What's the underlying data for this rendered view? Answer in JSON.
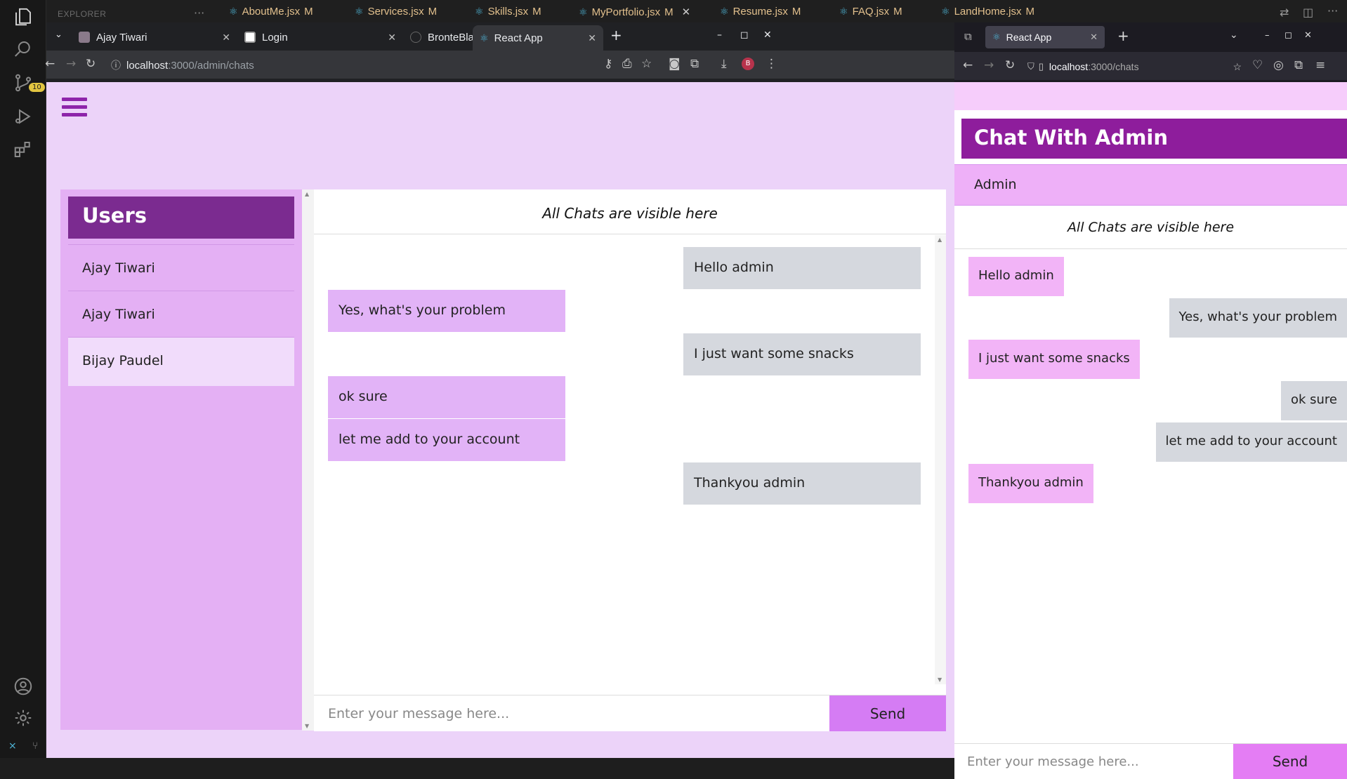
{
  "vscode": {
    "explorer_label": "EXPLORER",
    "scm_badge": "10",
    "tabs": [
      {
        "name": "AboutMe.jsx",
        "status": "M"
      },
      {
        "name": "Services.jsx",
        "status": "M"
      },
      {
        "name": "Skills.jsx",
        "status": "M"
      },
      {
        "name": "MyPortfolio.jsx",
        "status": "M"
      },
      {
        "name": "Resume.jsx",
        "status": "M"
      },
      {
        "name": "FAQ.jsx",
        "status": "M"
      },
      {
        "name": "LandHome.jsx",
        "status": "M"
      }
    ]
  },
  "chrome": {
    "tabs": [
      {
        "label": "Ajay Tiwari"
      },
      {
        "label": "Login"
      },
      {
        "label": "BronteBlaze/BookingPla"
      },
      {
        "label": "React App"
      }
    ],
    "url_host": "localhost",
    "url_path": ":3000/admin/chats",
    "profile_initial": "B",
    "page": {
      "users_title": "Users",
      "users": [
        {
          "name": "Ajay Tiwari"
        },
        {
          "name": "Ajay Tiwari"
        },
        {
          "name": "Bijay Paudel"
        }
      ],
      "chat_title": "All Chats are visible here",
      "messages": [
        {
          "text": "Hello admin",
          "side": "sent"
        },
        {
          "text": "Yes, what's your problem",
          "side": "recv"
        },
        {
          "text": "I just want some snacks",
          "side": "sent"
        },
        {
          "text": "ok sure",
          "side": "recv"
        },
        {
          "text": "let me add to your account",
          "side": "recv"
        },
        {
          "text": "Thankyou admin",
          "side": "sent"
        }
      ],
      "input_placeholder": "Enter your message here...",
      "send_label": "Send"
    }
  },
  "firefox": {
    "tab_label": "React App",
    "url_host": "localhost",
    "url_path": ":3000/chats",
    "page": {
      "header": "Chat With Admin",
      "contact": "Admin",
      "chat_title": "All Chats are visible here",
      "messages": [
        {
          "text": "Hello admin",
          "side": "recv"
        },
        {
          "text": "Yes, what's your problem",
          "side": "sent"
        },
        {
          "text": "I just want some snacks",
          "side": "recv"
        },
        {
          "text": "ok sure",
          "side": "sent"
        },
        {
          "text": "let me add to your account",
          "side": "sent"
        },
        {
          "text": "Thankyou admin",
          "side": "recv"
        }
      ],
      "input_placeholder": "Enter your message here...",
      "send_label": "Send"
    }
  },
  "colors": {
    "page_bg": "#ecd3f9",
    "sidebar_bg": "#e4b0f4",
    "users_header": "#7b2b90",
    "sent_bubble": "#d5d8de",
    "recv_bubble": "#e2b3f7",
    "send_button": "#d57cf4",
    "ff_header": "#8e1d9c"
  }
}
